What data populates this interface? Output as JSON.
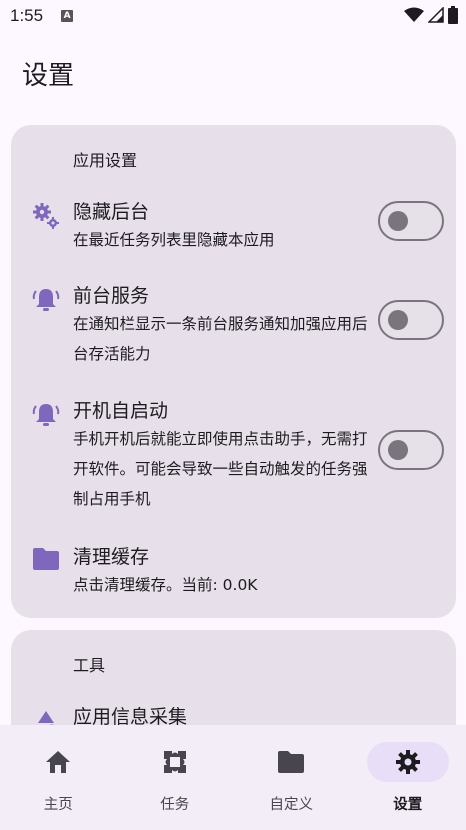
{
  "status_bar": {
    "time": "1:55",
    "notification_icon_letter": "A"
  },
  "header": {
    "title": "设置"
  },
  "sections": [
    {
      "header": "应用设置",
      "items": [
        {
          "icon": "gears-icon",
          "title": "隐藏后台",
          "description": "在最近任务列表里隐藏本应用",
          "toggle": false
        },
        {
          "icon": "bell-ring-icon",
          "title": "前台服务",
          "description": "在通知栏显示一条前台服务通知加强应用后台存活能力",
          "toggle": false
        },
        {
          "icon": "bell-ring-icon",
          "title": "开机自启动",
          "description": "手机开机后就能立即使用点击助手，无需打开软件。可能会导致一些自动触发的任务强制占用手机",
          "toggle": false
        },
        {
          "icon": "folder-icon",
          "title": "清理缓存",
          "description": "点击清理缓存。当前: 0.0K"
        }
      ]
    },
    {
      "header": "工具",
      "items": [
        {
          "icon": "shapes-icon",
          "title": "应用信息采集"
        }
      ]
    }
  ],
  "bottom_nav": {
    "items": [
      {
        "label": "主页",
        "icon": "home-icon",
        "active": false
      },
      {
        "label": "任务",
        "icon": "task-icon",
        "active": false
      },
      {
        "label": "自定义",
        "icon": "folder-icon",
        "active": false
      },
      {
        "label": "设置",
        "icon": "gear-icon",
        "active": true
      }
    ]
  },
  "colors": {
    "accent": "#7f67be",
    "card_bg": "#e7e0ea",
    "page_bg": "#fdf7ff",
    "nav_bg": "#f3edf7",
    "active_pill": "#e8def8",
    "toggle_outline": "#79747e"
  }
}
